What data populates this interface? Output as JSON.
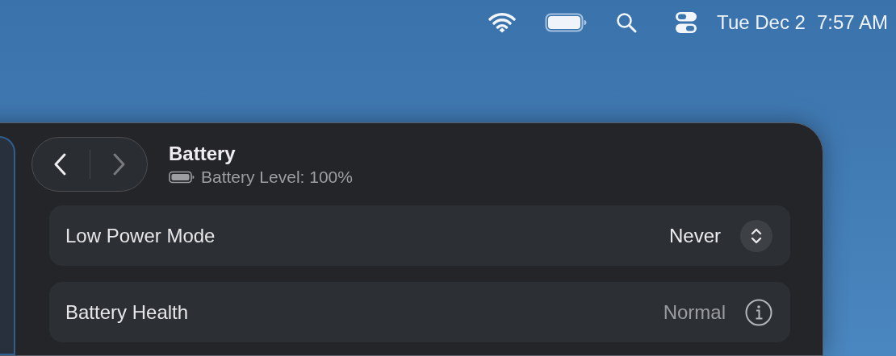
{
  "menu_bar": {
    "date": "Tue Dec 2",
    "time": "7:57 AM"
  },
  "window": {
    "navigation": {
      "back_disabled": false,
      "forward_disabled": true
    },
    "title": "Battery",
    "subtitle": "Battery Level: 100%",
    "rows": [
      {
        "kind": "popup",
        "label": "Low Power Mode",
        "value": "Never"
      },
      {
        "kind": "info",
        "label": "Battery Health",
        "value": "Normal"
      }
    ]
  }
}
